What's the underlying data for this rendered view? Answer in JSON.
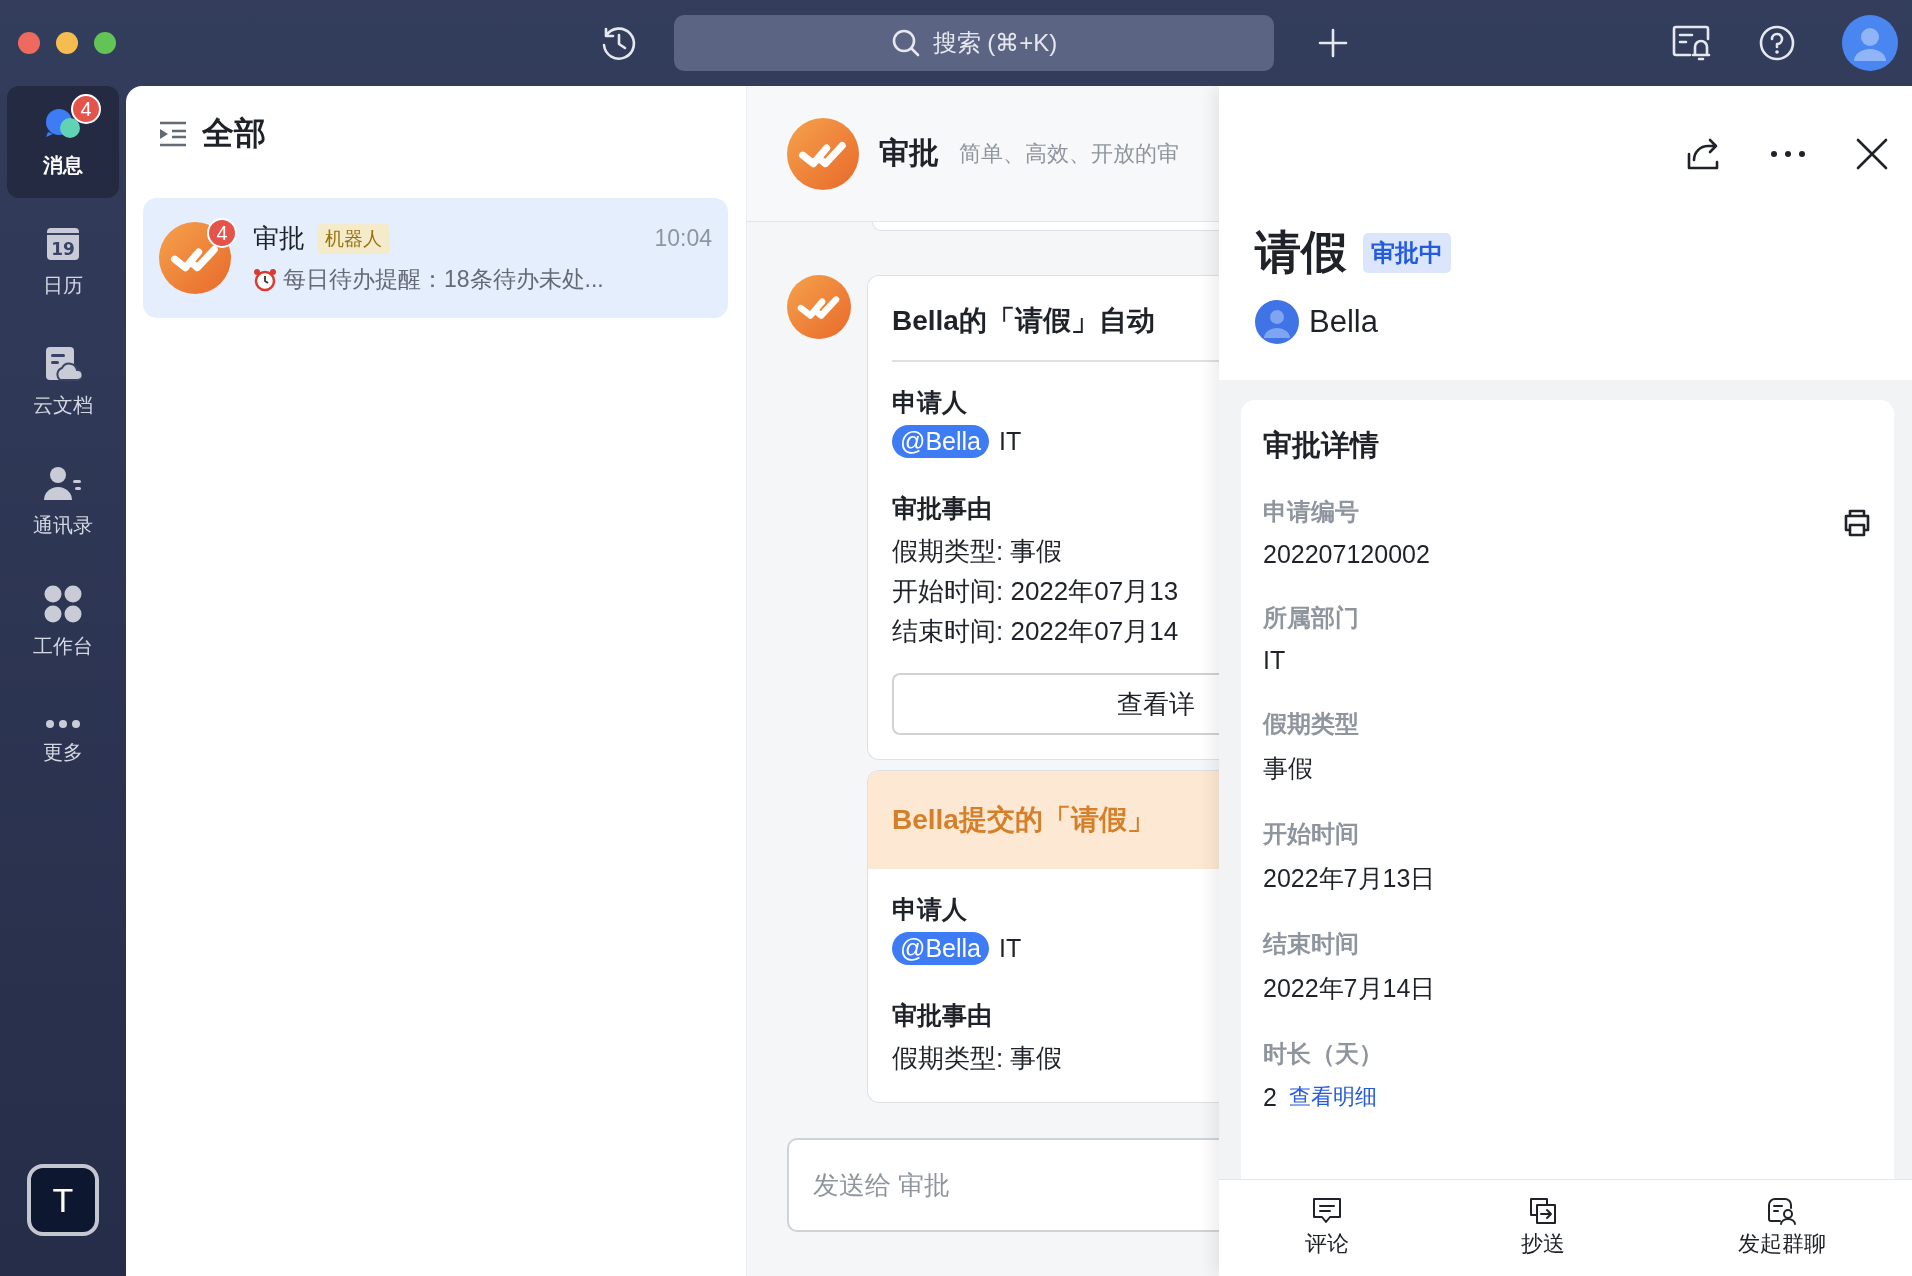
{
  "top_bar": {
    "search": {
      "label": "搜索 (⌘+K)"
    }
  },
  "sidebar": {
    "items": [
      {
        "label": "消息",
        "kind": "messages",
        "badge": "4",
        "selected": true
      },
      {
        "label": "日历",
        "kind": "calendar",
        "date": "19",
        "selected": false
      },
      {
        "label": "云文档",
        "kind": "docs",
        "selected": false
      },
      {
        "label": "通讯录",
        "kind": "contacts",
        "selected": false
      },
      {
        "label": "工作台",
        "kind": "workspace",
        "selected": false
      },
      {
        "label": "更多",
        "kind": "more",
        "selected": false
      }
    ],
    "user_initial": "T"
  },
  "chat_list": {
    "title": "全部",
    "chats": [
      {
        "name": "审批",
        "tag": "机器人",
        "time": "10:04",
        "preview": "每日待办提醒：18条待办未处...",
        "badge": "4",
        "selected": true
      }
    ]
  },
  "conversation": {
    "title": "审批",
    "subtitle": "简单、高效、开放的审",
    "cards": [
      {
        "kind": "plain",
        "title": "Bella的「请假」自动",
        "applicant": {
          "heading": "申请人",
          "mention": "@Bella",
          "department": "IT"
        },
        "reason": {
          "heading": "审批事由",
          "lines": [
            "假期类型: 事假",
            "开始时间: 2022年07月13",
            "结束时间: 2022年07月14"
          ]
        },
        "button": "查看详"
      },
      {
        "kind": "highlight",
        "title": "Bella提交的「请假」",
        "applicant": {
          "heading": "申请人",
          "mention": "@Bella",
          "department": "IT"
        },
        "reason": {
          "heading": "审批事由",
          "lines": [
            "假期类型: 事假"
          ]
        }
      }
    ],
    "composer": {
      "placeholder": "发送给 审批"
    }
  },
  "detail": {
    "title": "请假",
    "status": "审批中",
    "applicant": "Bella",
    "section_title": "审批详情",
    "fields": [
      {
        "label": "申请编号",
        "value": "202207120002"
      },
      {
        "label": "所属部门",
        "value": "IT"
      },
      {
        "label": "假期类型",
        "value": "事假"
      },
      {
        "label": "开始时间",
        "value": "2022年7月13日"
      },
      {
        "label": "结束时间",
        "value": "2022年7月14日"
      },
      {
        "label": "时长（天）",
        "value": "2",
        "link": "查看明细"
      }
    ],
    "actions": [
      {
        "label": "评论",
        "kind": "comment"
      },
      {
        "label": "抄送",
        "kind": "cc"
      },
      {
        "label": "发起群聊",
        "kind": "group-chat"
      }
    ]
  }
}
